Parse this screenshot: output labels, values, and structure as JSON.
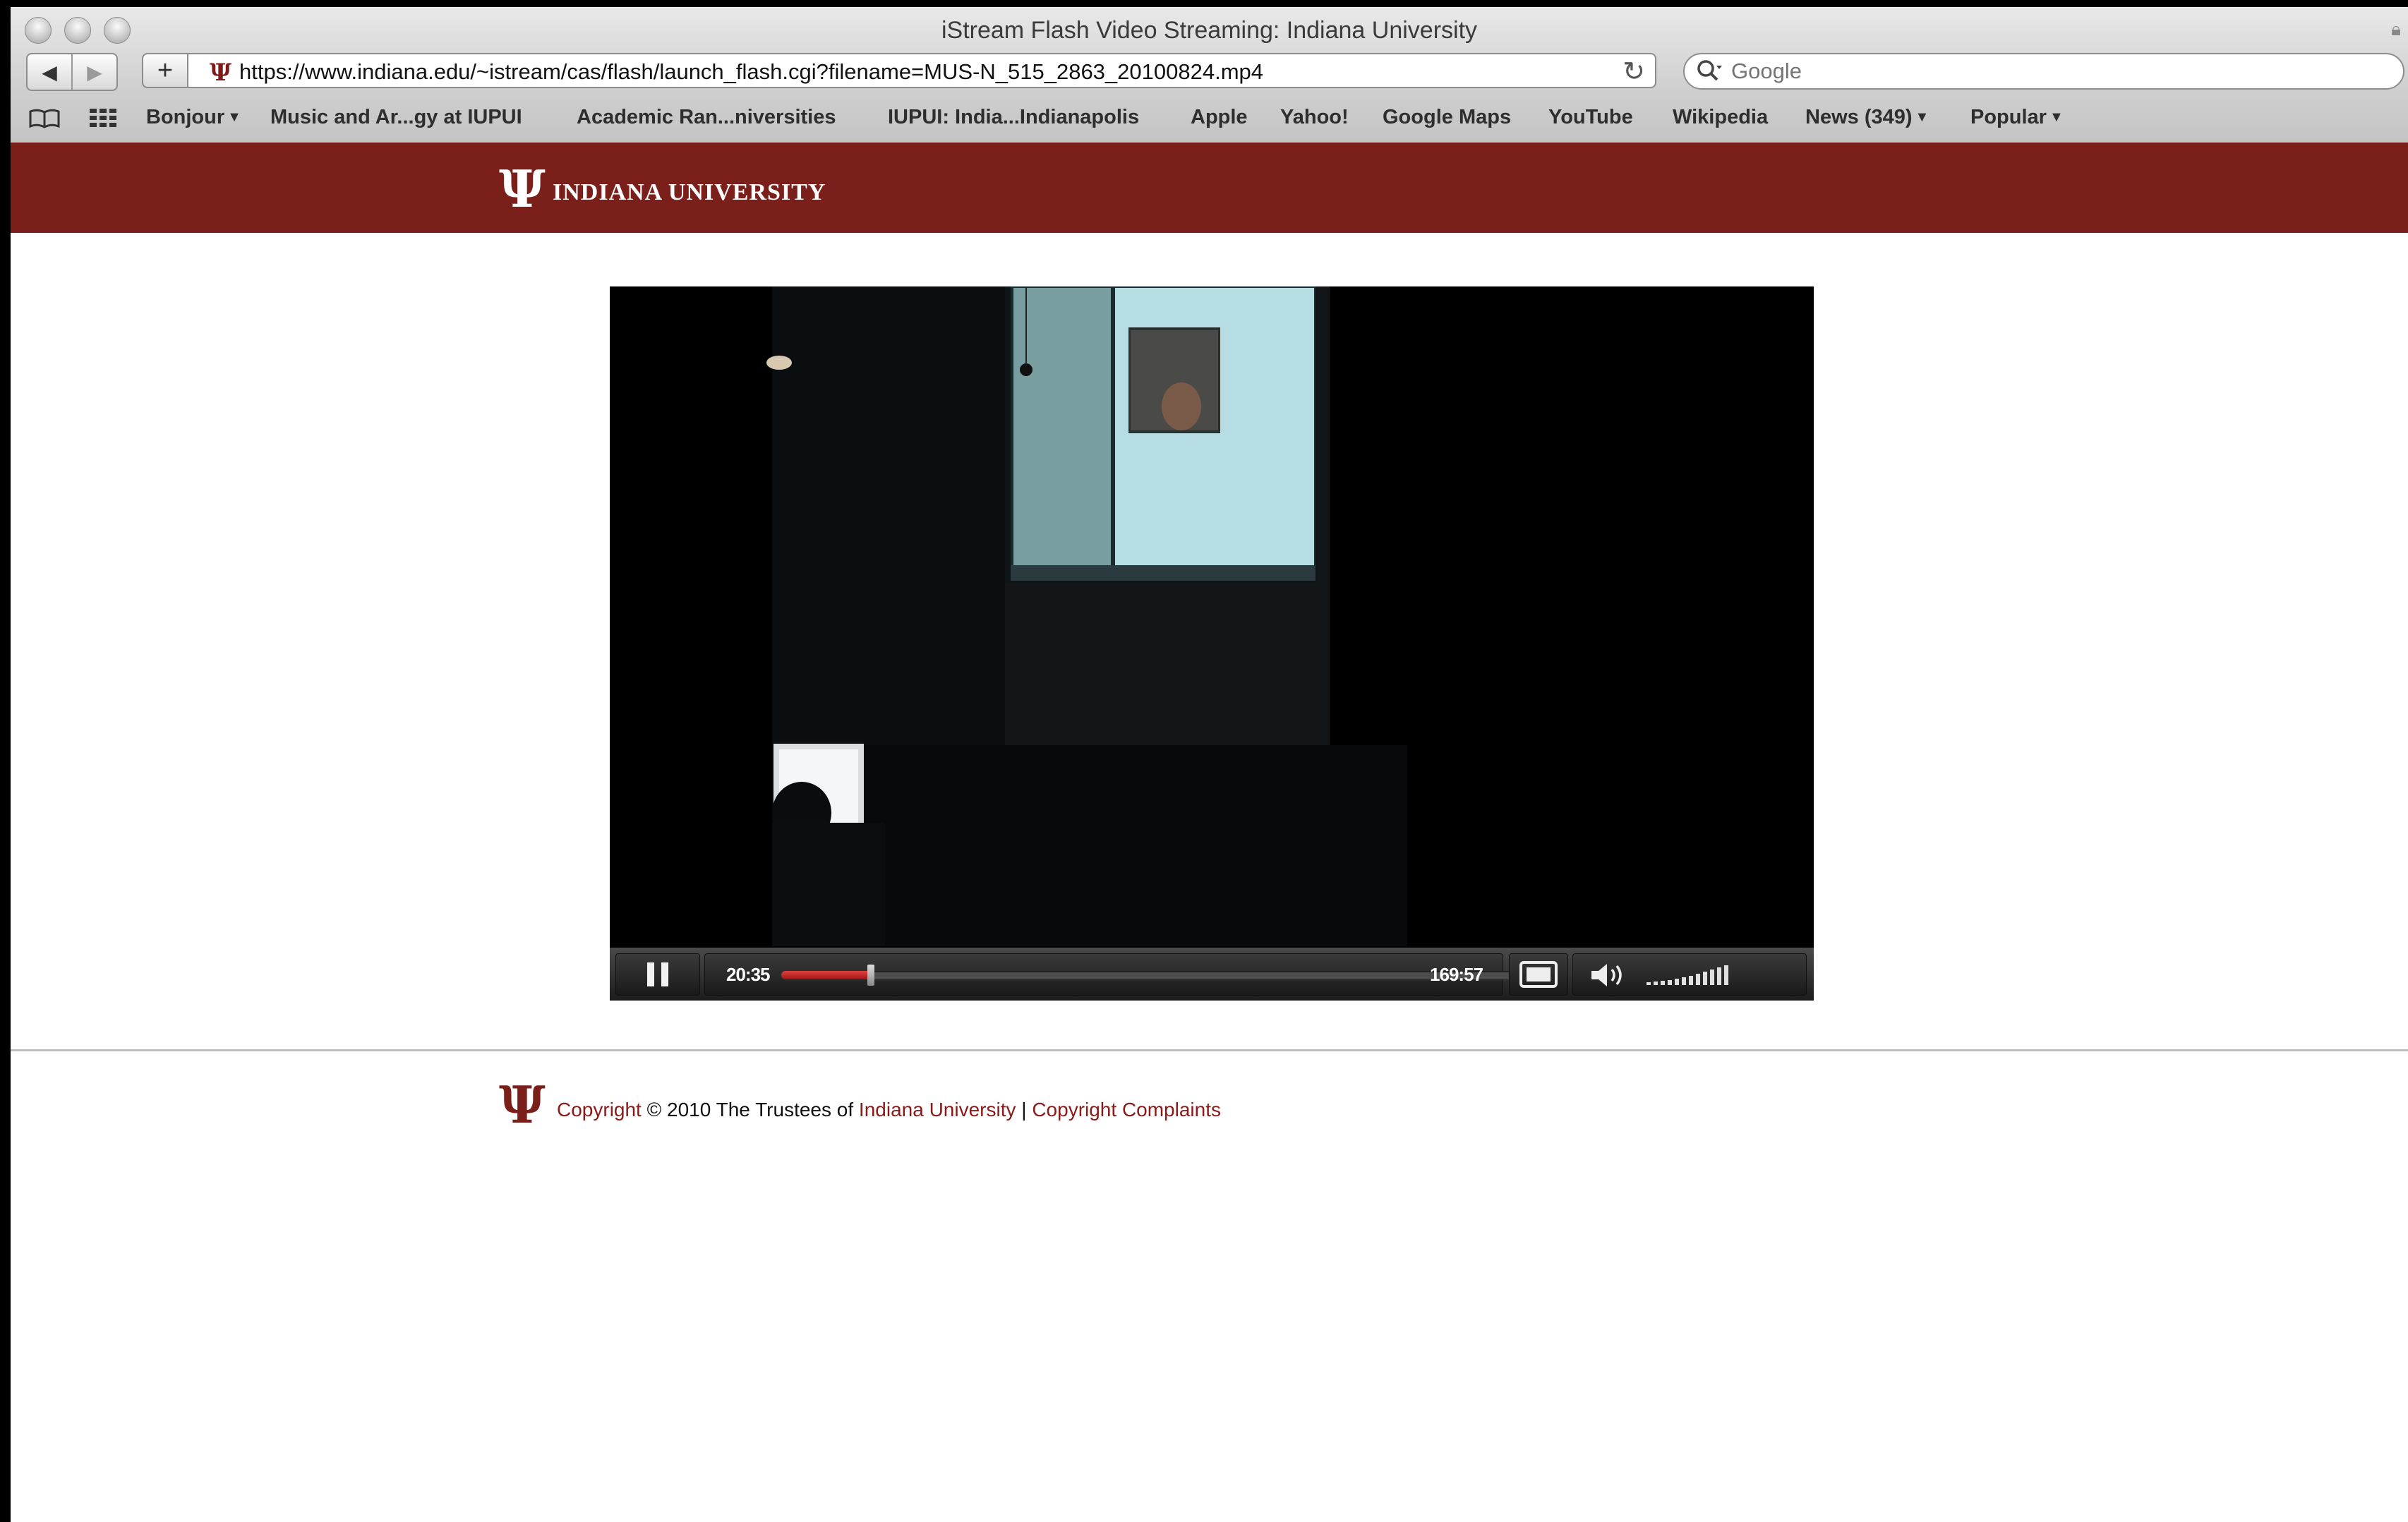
{
  "window": {
    "title": "iStream Flash Video Streaming: Indiana University"
  },
  "toolbar": {
    "url": "https://www.indiana.edu/~istream/cas/flash/launch_flash.cgi?filename=MUS-N_515_2863_20100824.mp4",
    "search_placeholder": "Google"
  },
  "bookmarks": [
    {
      "label": "Bonjour",
      "has_menu": true
    },
    {
      "label": "Music and Ar...gy at IUPUI"
    },
    {
      "label": "Academic Ran...niversities"
    },
    {
      "label": "IUPUI: India...Indianapolis"
    },
    {
      "label": "Apple"
    },
    {
      "label": "Yahoo!"
    },
    {
      "label": "Google Maps"
    },
    {
      "label": "YouTube"
    },
    {
      "label": "Wikipedia"
    },
    {
      "label": "News (349)",
      "has_menu": true
    },
    {
      "label": "Popular",
      "has_menu": true
    }
  ],
  "banner": {
    "name": "INDIANA UNIVERSITY"
  },
  "player": {
    "elapsed": "20:35",
    "total": "169:57",
    "progress_fraction": 0.121
  },
  "footer": {
    "copyright_link": "Copyright",
    "copyright_text": " © 2010 The Trustees of ",
    "university_link": "Indiana University",
    "separator": " | ",
    "complaints_link": "Copyright Complaints"
  },
  "colors": {
    "iu_crimson": "#7b1f1b",
    "progress_red": "#c62828"
  }
}
